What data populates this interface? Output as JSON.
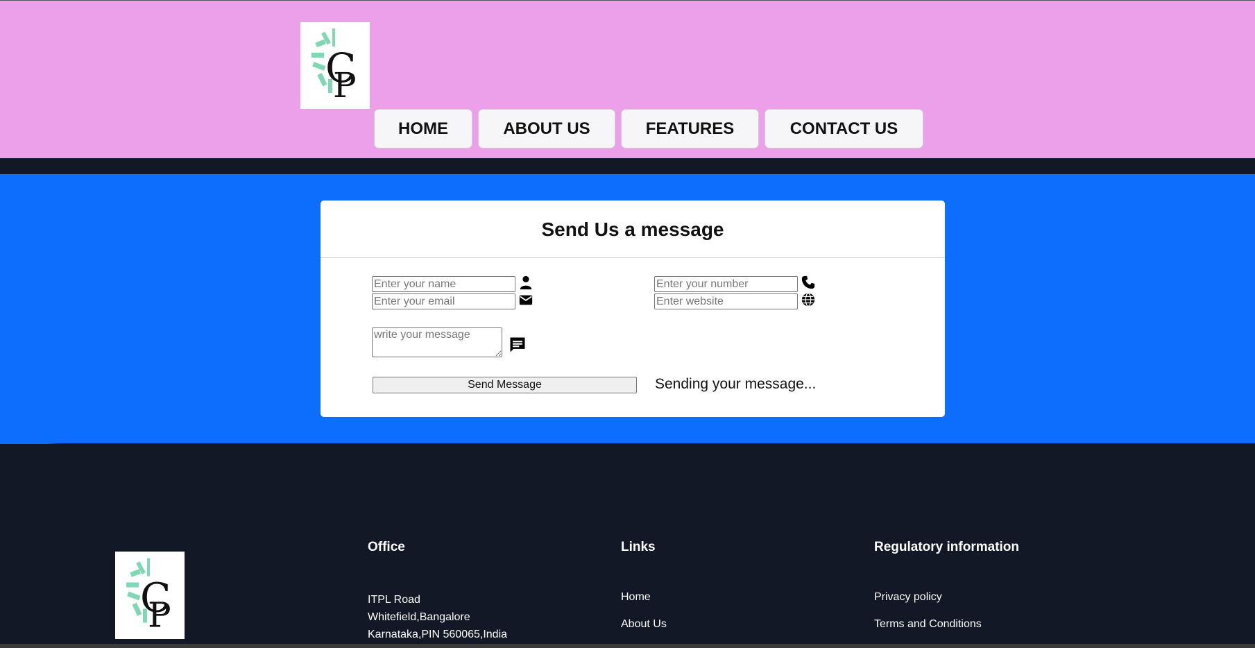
{
  "nav": {
    "home": "HOME",
    "about": "ABOUT US",
    "features": "FEATURES",
    "contact": "CONTACT US"
  },
  "form": {
    "title": "Send Us a message",
    "name_placeholder": "Enter your name",
    "email_placeholder": "Enter your email",
    "number_placeholder": "Enter your number",
    "website_placeholder": "Enter website",
    "message_placeholder": "write your message",
    "submit_label": "Send Message",
    "status_text": "Sending your message..."
  },
  "footer": {
    "office": {
      "heading": "Office",
      "lines": [
        "ITPL Road",
        "Whitefield,Bangalore",
        "Karnataka,PIN 560065,India"
      ]
    },
    "links": {
      "heading": "Links",
      "items": [
        "Home",
        "About Us"
      ]
    },
    "regulatory": {
      "heading": "Regulatory information",
      "items": [
        "Privacy policy",
        "Terms and Conditions"
      ]
    }
  },
  "colors": {
    "header_bg": "#eca0e9",
    "form_section_bg": "#0d6efd",
    "footer_bg": "#121826"
  },
  "icons": [
    "logo-icon",
    "user-icon",
    "envelope-icon",
    "phone-icon",
    "globe-icon",
    "message-icon"
  ]
}
